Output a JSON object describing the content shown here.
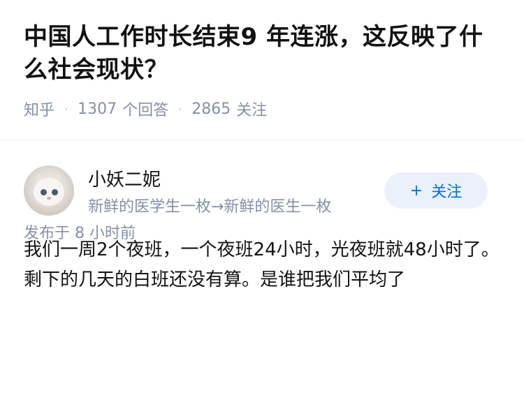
{
  "question": {
    "title": "中国人工作时长结束9 年连涨，这反映了什么社会现状？",
    "source": "知乎",
    "answers_count": "1307",
    "answers_label": "个回答",
    "followers_count": "2865",
    "followers_label": "关注"
  },
  "answer": {
    "author": {
      "name": "小妖二妮",
      "bio": "新鲜的医学生一枚→新鲜的医生一枚",
      "avatar_icon": "white-kitten-avatar"
    },
    "follow_button": {
      "plus": "+",
      "label": "关注"
    },
    "content": "我们一周2个夜班，一个夜班24小时，光夜班就48小时了。剩下的几天的白班还没有算。是谁把我们平均了",
    "time": "发布于  8 小时前"
  },
  "colors": {
    "text": "#121212",
    "meta": "#8590a6",
    "accent": "#056de8",
    "button_bg": "#ebf1fb"
  }
}
